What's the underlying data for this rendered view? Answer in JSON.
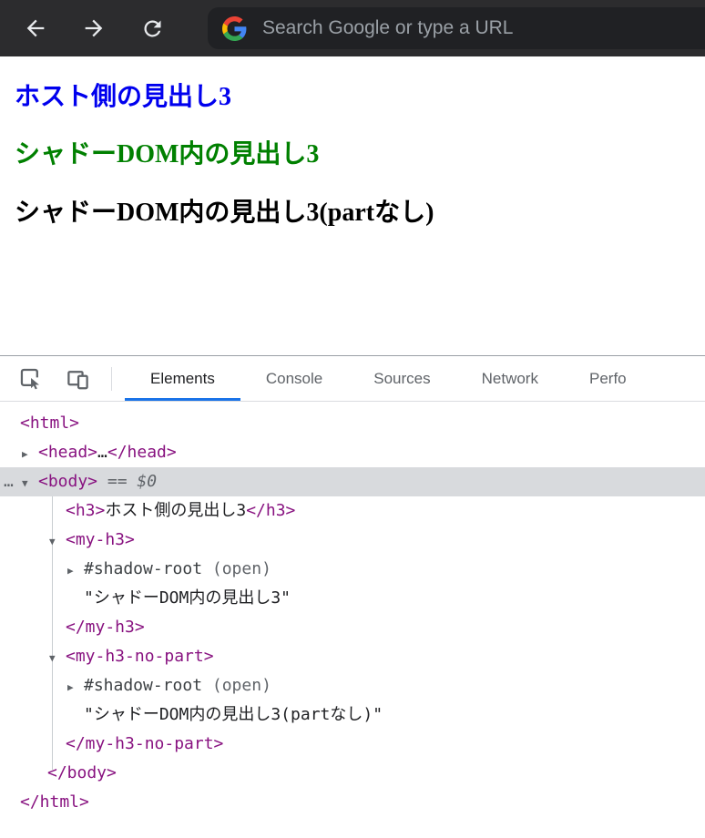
{
  "browser": {
    "search_placeholder": "Search Google or type a URL",
    "toolbar_bg": "#2c2c2e",
    "omnibox_bg": "#202124",
    "icon_color": "#e8eaed",
    "placeholder_color": "#9aa0a6"
  },
  "page": {
    "headings": [
      {
        "text": "ホスト側の見出し3",
        "color": "#0000ee"
      },
      {
        "text": "シャドーDOM内の見出し3",
        "color": "#008000"
      },
      {
        "text": "シャドーDOM内の見出し3(partなし)",
        "color": "#000000"
      }
    ]
  },
  "devtools": {
    "tabs": [
      {
        "label": "Elements",
        "selected": true
      },
      {
        "label": "Console",
        "selected": false
      },
      {
        "label": "Sources",
        "selected": false
      },
      {
        "label": "Network",
        "selected": false
      },
      {
        "label": "Perfo",
        "selected": false
      }
    ],
    "accent_color": "#1a73e8",
    "tag_color": "#881280",
    "muted_color": "#5f6368",
    "selected_row_bg": "#d8dadd",
    "tree": [
      {
        "pad": 22,
        "parts": [
          {
            "t": "<html>",
            "c": "tag"
          }
        ]
      },
      {
        "pad": 24,
        "arrow": "right",
        "parts": [
          {
            "t": "<head>",
            "c": "tag"
          },
          {
            "t": "…",
            "c": "text"
          },
          {
            "t": "</head>",
            "c": "tag"
          }
        ]
      },
      {
        "pad": 24,
        "arrow": "down",
        "selected": true,
        "gutter": "…",
        "parts": [
          {
            "t": "<body>",
            "c": "tag"
          },
          {
            "t": " == ",
            "c": "muted"
          },
          {
            "t": "$0",
            "c": "dollar"
          }
        ]
      },
      {
        "pad": 72,
        "parts": [
          {
            "t": "<h3>",
            "c": "tag"
          },
          {
            "t": "ホスト側の見出し3",
            "c": "text"
          },
          {
            "t": "</h3>",
            "c": "tag"
          }
        ]
      },
      {
        "pad": 54,
        "arrow": "down",
        "parts": [
          {
            "t": "<my-h3>",
            "c": "tag"
          }
        ]
      },
      {
        "pad": 74,
        "arrow": "right",
        "parts": [
          {
            "t": "#shadow-root",
            "c": "shadow"
          },
          {
            "t": " (open)",
            "c": "open"
          }
        ]
      },
      {
        "pad": 92,
        "parts": [
          {
            "t": "\"シャドーDOM内の見出し3\"",
            "c": "text"
          }
        ]
      },
      {
        "pad": 72,
        "parts": [
          {
            "t": "</my-h3>",
            "c": "tag"
          }
        ]
      },
      {
        "pad": 54,
        "arrow": "down",
        "parts": [
          {
            "t": "<my-h3-no-part>",
            "c": "tag"
          }
        ]
      },
      {
        "pad": 74,
        "arrow": "right",
        "parts": [
          {
            "t": "#shadow-root",
            "c": "shadow"
          },
          {
            "t": " (open)",
            "c": "open"
          }
        ]
      },
      {
        "pad": 92,
        "parts": [
          {
            "t": "\"シャドーDOM内の見出し3(partなし)\"",
            "c": "text"
          }
        ]
      },
      {
        "pad": 72,
        "parts": [
          {
            "t": "</my-h3-no-part>",
            "c": "tag"
          }
        ]
      },
      {
        "pad": 52,
        "parts": [
          {
            "t": "</body>",
            "c": "tag"
          }
        ]
      },
      {
        "pad": 22,
        "parts": [
          {
            "t": "</html>",
            "c": "tag"
          }
        ]
      }
    ]
  }
}
